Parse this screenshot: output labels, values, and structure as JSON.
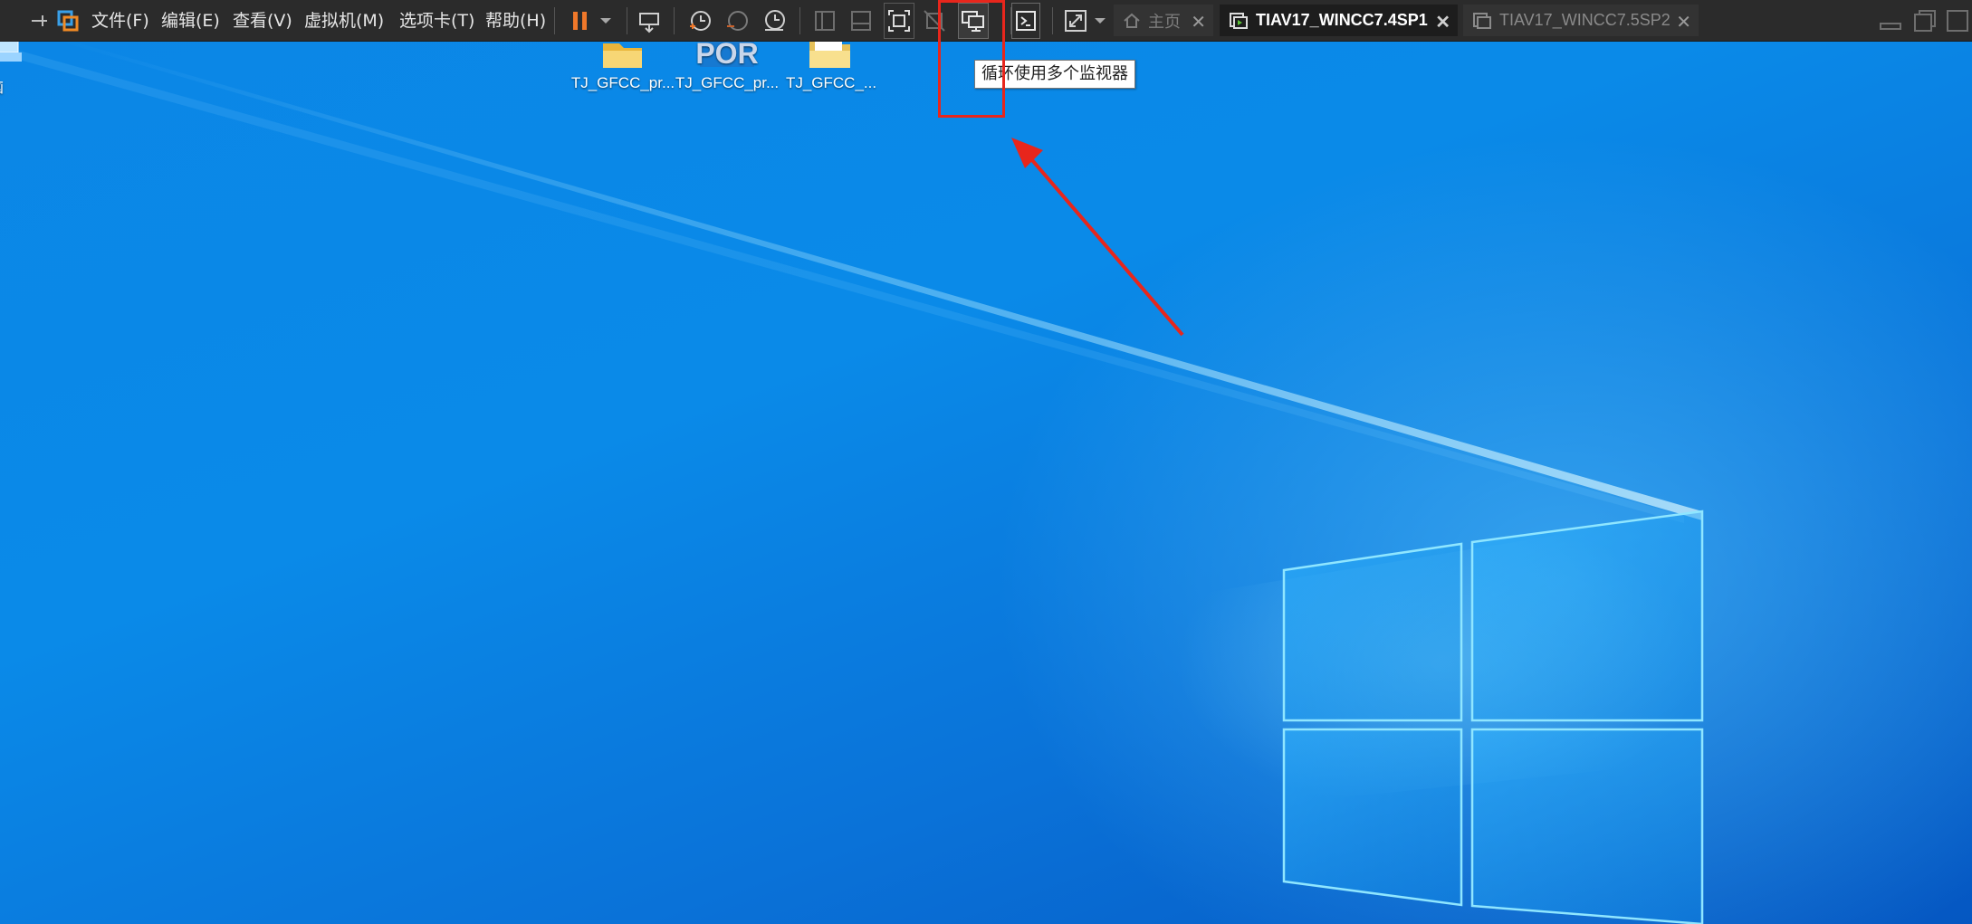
{
  "app": {
    "menus": [
      "文件(F)",
      "编辑(E)",
      "查看(V)",
      "虚拟机(M)",
      "选项卡(T)",
      "帮助(H)"
    ],
    "tabs": [
      {
        "label": "主页",
        "state": "inactive",
        "icon": "home-icon"
      },
      {
        "label": "TIAV17_WINCC7.4SP1",
        "state": "active",
        "icon": "vm-running-icon"
      },
      {
        "label": "TIAV17_WINCC7.5SP2",
        "state": "inactive",
        "icon": "vm-icon"
      }
    ],
    "toolbar_icons": [
      "pin-icon",
      "vmware-logo-icon",
      "pause-icon",
      "dropdown-arrow-icon",
      "send-ctrl-alt-del-icon",
      "snapshot-icon",
      "revert-snapshot-icon",
      "snapshot-manager-icon",
      "library-view-icon",
      "thumbnail-view-icon",
      "fit-guest-icon",
      "disable-stretch-icon",
      "cycle-monitors-icon",
      "console-icon",
      "fullscreen-icon",
      "minimize-icon",
      "restore-icon"
    ],
    "tooltip": "循环使用多个监视器"
  },
  "desktop": {
    "left_icon_label": "电脑",
    "icons": [
      {
        "label": "TJ_GFCC_pr...",
        "icon": "folder-icon"
      },
      {
        "label": "TJ_GFCC_pr...",
        "icon": "portal-file-icon"
      },
      {
        "label": "TJ_GFCC_...",
        "icon": "folder-icon"
      }
    ],
    "icon_partial_text": "POR"
  },
  "colors": {
    "toolbar_bg": "#2b2b2b",
    "desktop_blue": "#0a8ae8",
    "highlight": "#e8261c",
    "pause_orange": "#f0782a"
  }
}
